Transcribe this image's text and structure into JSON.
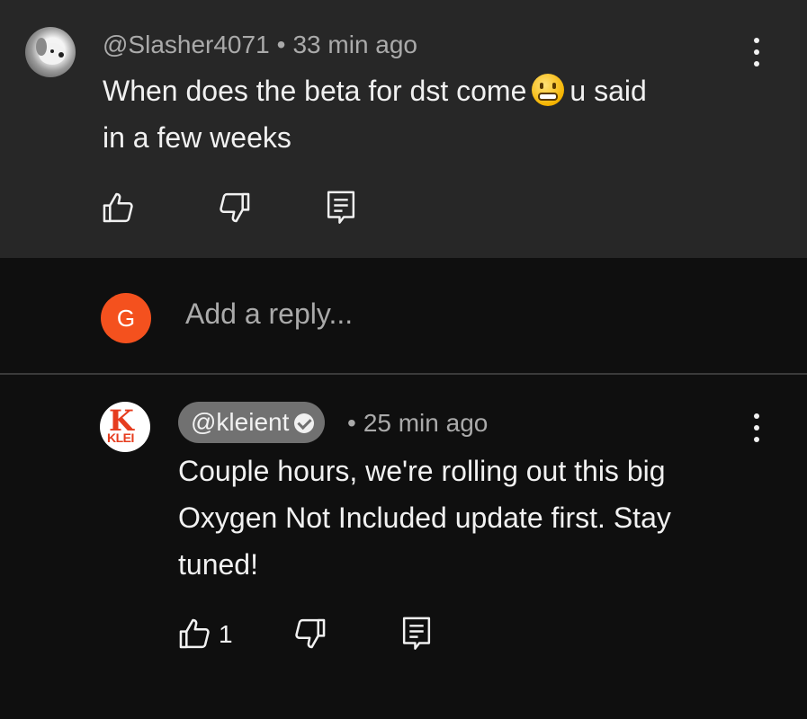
{
  "comment": {
    "author": "@Slasher4071",
    "time": "33 min ago",
    "text_before_emoji": "When does the beta for dst come",
    "emoji": "grimacing-face",
    "text_after_emoji": "u said",
    "text_line2": "in a few weeks",
    "like_count": ""
  },
  "reply_box": {
    "avatar_letter": "G",
    "placeholder": "Add a reply..."
  },
  "reply": {
    "author": "@kleient",
    "verified": true,
    "time": "25 min ago",
    "line1": "Couple hours, we're rolling out this big",
    "line2": "Oxygen Not Included update first. Stay",
    "line3": "tuned!",
    "like_count": "1",
    "avatar_text": "KLEI"
  },
  "separator": "•",
  "colors": {
    "background": "#0f0f0f",
    "highlight_background": "#272727",
    "text_primary": "#f1f1f1",
    "text_secondary": "#aaaaaa",
    "avatar_g": "#f4511e",
    "author_chip": "#717171"
  }
}
